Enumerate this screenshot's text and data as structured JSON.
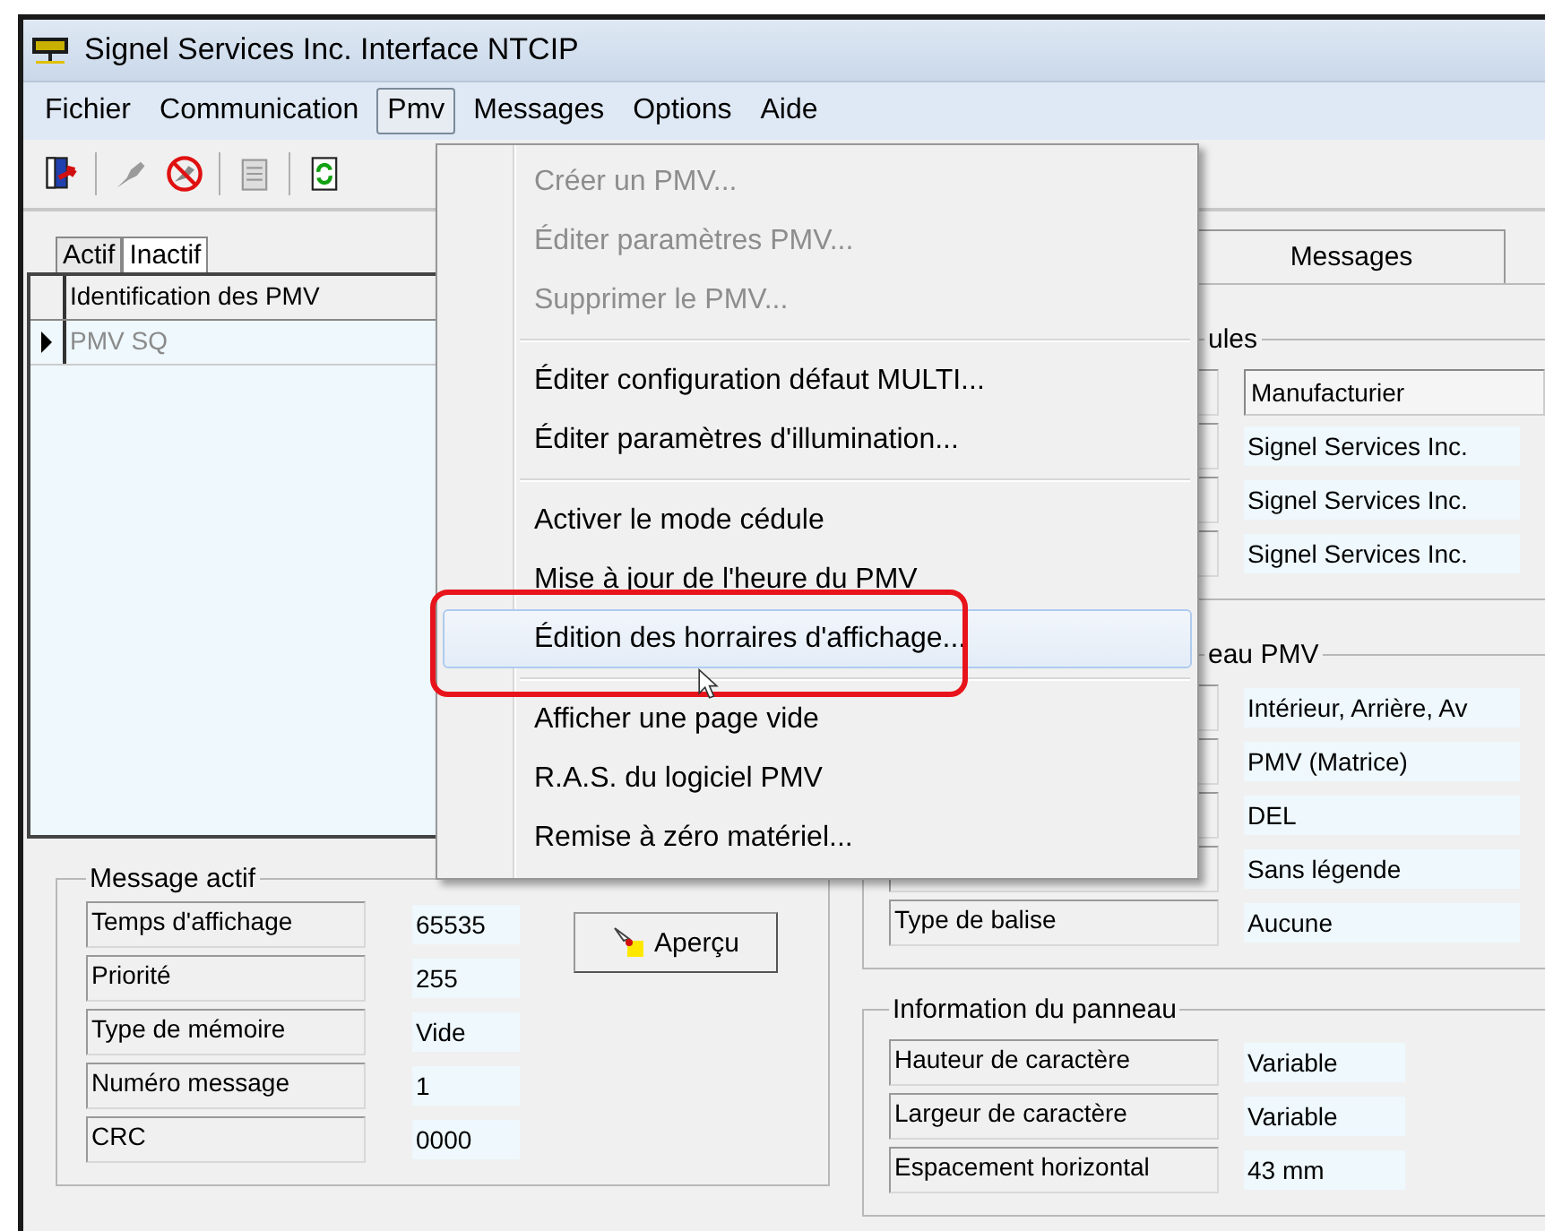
{
  "window": {
    "title": "Signel Services Inc. Interface NTCIP"
  },
  "menu_bar": [
    {
      "label": "Fichier",
      "selected": false
    },
    {
      "label": "Communication",
      "selected": false
    },
    {
      "label": "Pmv",
      "selected": true
    },
    {
      "label": "Messages",
      "selected": false
    },
    {
      "label": "Options",
      "selected": false
    },
    {
      "label": "Aide",
      "selected": false
    }
  ],
  "left_panel": {
    "tabs": [
      {
        "label": "Actif",
        "selected": false
      },
      {
        "label": "Inactif",
        "selected": true
      }
    ],
    "grid": {
      "columns": [
        "Identification des PMV"
      ],
      "rows": [
        {
          "cells": [
            "PMV SQ"
          ],
          "selected": true
        }
      ]
    }
  },
  "message_actif": {
    "title": "Message actif",
    "fields": [
      {
        "label": "Temps d'affichage",
        "value": "65535"
      },
      {
        "label": "Priorité",
        "value": "255"
      },
      {
        "label": "Type de mémoire",
        "value": "Vide"
      },
      {
        "label": "Numéro message",
        "value": "1"
      },
      {
        "label": "CRC",
        "value": "0000"
      }
    ],
    "button": "Aperçu"
  },
  "right_panel": {
    "tabs": [
      {
        "label": "Messages",
        "selected": false
      }
    ],
    "groups": [
      {
        "title": "ules",
        "rows": [
          {
            "kind": "field",
            "value": "Manufacturier"
          },
          {
            "kind": "text",
            "value": "Signel Services Inc."
          },
          {
            "kind": "text",
            "value": "Signel Services Inc."
          },
          {
            "kind": "text",
            "value": "Signel Services Inc."
          }
        ]
      },
      {
        "title": "eau PMV",
        "rows": [
          {
            "kind": "text",
            "value": "Intérieur, Arrière, Av"
          },
          {
            "kind": "text",
            "value": "PMV (Matrice)"
          },
          {
            "kind": "text",
            "value": "DEL"
          },
          {
            "kind": "text",
            "value": "Sans légende"
          },
          {
            "kind": "text",
            "label": "Type de balise",
            "value": "Aucune"
          }
        ]
      },
      {
        "title": "Information du panneau",
        "rows": [
          {
            "kind": "text",
            "label": "Hauteur de caractère",
            "value": "Variable"
          },
          {
            "kind": "text",
            "label": "Largeur de caractère",
            "value": "Variable"
          },
          {
            "kind": "text",
            "label": "Espacement horizontal",
            "value": "43 mm"
          }
        ]
      }
    ]
  },
  "dropdown": {
    "items": [
      {
        "kind": "item",
        "label": "Créer un PMV...",
        "disabled": true,
        "selected": false
      },
      {
        "kind": "item",
        "label": "Éditer paramètres PMV...",
        "disabled": true,
        "selected": false
      },
      {
        "kind": "item",
        "label": "Supprimer le PMV...",
        "disabled": true,
        "selected": false
      },
      {
        "kind": "separator"
      },
      {
        "kind": "item",
        "label": "Éditer configuration défaut MULTI...",
        "disabled": false,
        "selected": false
      },
      {
        "kind": "item",
        "label": "Éditer paramètres d'illumination...",
        "disabled": false,
        "selected": false
      },
      {
        "kind": "separator"
      },
      {
        "kind": "item",
        "label": "Activer le mode cédule",
        "disabled": false,
        "selected": false
      },
      {
        "kind": "item",
        "label": "Mise à jour de l'heure du PMV",
        "disabled": false,
        "selected": false
      },
      {
        "kind": "item",
        "label": "Édition des horraires d'affichage...",
        "disabled": false,
        "selected": true
      },
      {
        "kind": "separator"
      },
      {
        "kind": "item",
        "label": "Afficher une page vide",
        "disabled": false,
        "selected": false
      },
      {
        "kind": "item",
        "label": "R.A.S. du logiciel PMV",
        "disabled": false,
        "selected": false
      },
      {
        "kind": "item",
        "label": "Remise à zéro matériel...",
        "disabled": false,
        "selected": false
      }
    ]
  }
}
